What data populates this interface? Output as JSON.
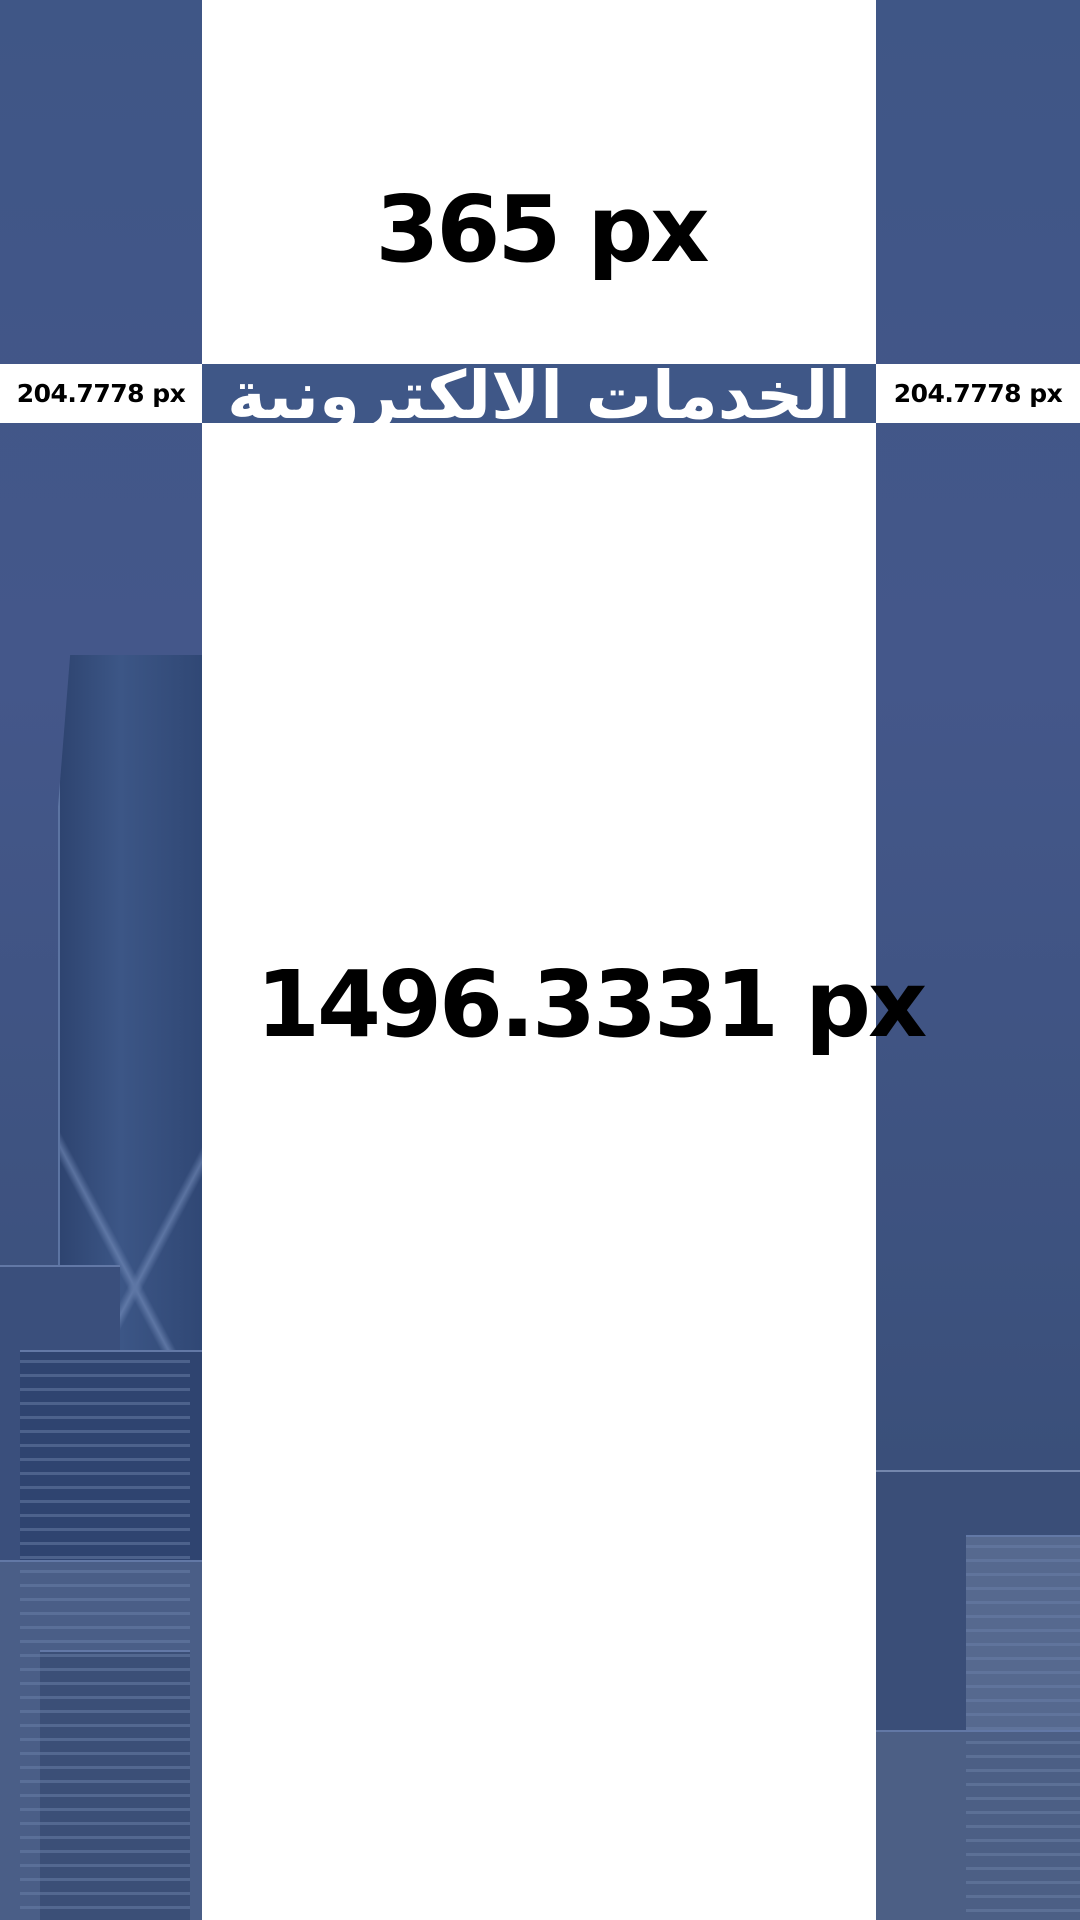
{
  "header_height_label": "365 px",
  "side_margin_left_label": "204.7778 px",
  "side_margin_right_label": "204.7778 px",
  "title": "الخدمات الالكترونية",
  "content_height_label": "1496.3331 px",
  "colors": {
    "brand_blue": "#3f5787",
    "panel_white": "#ffffff",
    "text_black": "#000000"
  },
  "background_image": "city-skyline-photo"
}
